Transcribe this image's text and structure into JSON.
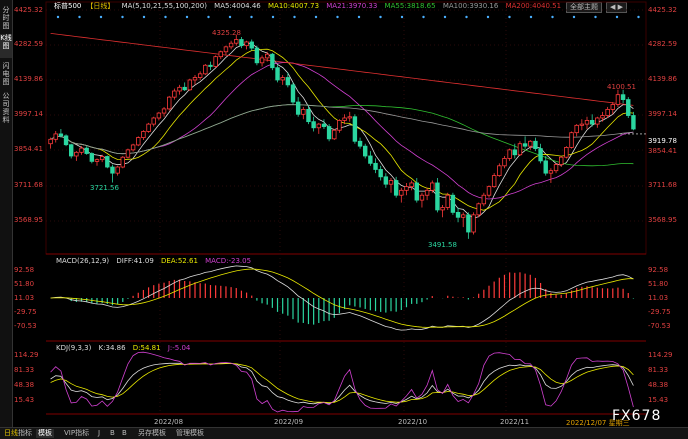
{
  "sidebar": {
    "tabs": [
      {
        "label": "分时图",
        "active": false
      },
      {
        "label": "K线图",
        "active": true
      },
      {
        "label": "闪电图",
        "active": false
      },
      {
        "label": "公司资料",
        "active": false
      }
    ]
  },
  "header": {
    "name": "标普500",
    "period": "【日线】",
    "ma": [
      {
        "label": "MA(5,10,21,55,100,200)",
        "color": "#dddddd"
      },
      {
        "label": "MA5:4004.46",
        "color": "#dddddd"
      },
      {
        "label": "MA10:4007.73",
        "color": "#e8e800"
      },
      {
        "label": "MA21:3970.33",
        "color": "#d040d0"
      },
      {
        "label": "MA55:3818.65",
        "color": "#30c030"
      },
      {
        "label": "MA100:3930.16",
        "color": "#999999"
      },
      {
        "label": "MA200:4040.51",
        "color": "#e03030"
      }
    ],
    "buttons": {
      "all": "全部主题",
      "nav": "◀ ▶"
    }
  },
  "price_axis": {
    "left": [
      "4425.32",
      "4282.59",
      "4139.86",
      "3997.14",
      "3854.41",
      "3711.68",
      "3568.95"
    ],
    "right": [
      "4425.32",
      "4282.59",
      "4139.86",
      "3997.14",
      "3854.41",
      "3711.68",
      "3568.95"
    ],
    "last": "3919.78"
  },
  "annotations": {
    "high": "4325.28",
    "low_left": "3721.56",
    "low": "3491.58",
    "recent_high": "4100.51"
  },
  "macd": {
    "title": "MACD(26,12,9)",
    "diff": "DIFF:41.09",
    "dea": "DEA:52.61",
    "macd": "MACD:-23.05",
    "axis": [
      "92.58",
      "51.80",
      "11.03",
      "-29.75",
      "-70.53"
    ]
  },
  "kdj": {
    "title": "KDJ(9,3,3)",
    "k": "K:34.86",
    "d": "D:54.81",
    "j": "J:-5.04",
    "axis": [
      "114.29",
      "81.33",
      "48.38",
      "15.43"
    ]
  },
  "x_axis": [
    "2022/08",
    "2022/09",
    "2022/10",
    "2022/11"
  ],
  "status": {
    "date": "2022/12/07 星期三"
  },
  "bottom_tabs": [
    {
      "label": "日线",
      "active": false
    },
    {
      "label": "指标",
      "active": false
    },
    {
      "label": "模板",
      "active": true
    },
    {
      "label": "VIP指标",
      "active": false
    },
    {
      "label": "J",
      "active": false
    },
    {
      "label": "B",
      "active": false
    },
    {
      "label": "B",
      "active": false
    },
    {
      "label": "另存模板",
      "active": false
    },
    {
      "label": "管理模板",
      "active": false
    }
  ],
  "brand": "FX678",
  "colors": {
    "up": "#ff3b3b",
    "down": "#2bd6a0",
    "bg": "#000000"
  },
  "chart_data": {
    "type": "candlestick",
    "candles": [
      [
        3880,
        3905,
        3860,
        3898
      ],
      [
        3898,
        3932,
        3885,
        3920
      ],
      [
        3920,
        3940,
        3905,
        3912
      ],
      [
        3912,
        3918,
        3870,
        3876
      ],
      [
        3876,
        3880,
        3820,
        3830
      ],
      [
        3830,
        3850,
        3810,
        3845
      ],
      [
        3845,
        3870,
        3835,
        3862
      ],
      [
        3862,
        3870,
        3835,
        3840
      ],
      [
        3840,
        3845,
        3800,
        3808
      ],
      [
        3808,
        3820,
        3790,
        3815
      ],
      [
        3815,
        3835,
        3805,
        3828
      ],
      [
        3828,
        3832,
        3780,
        3785
      ],
      [
        3785,
        3795,
        3722,
        3760
      ],
      [
        3760,
        3790,
        3750,
        3785
      ],
      [
        3785,
        3830,
        3780,
        3825
      ],
      [
        3825,
        3860,
        3820,
        3855
      ],
      [
        3855,
        3880,
        3848,
        3875
      ],
      [
        3875,
        3910,
        3870,
        3905
      ],
      [
        3905,
        3935,
        3895,
        3930
      ],
      [
        3930,
        3965,
        3925,
        3960
      ],
      [
        3960,
        3990,
        3950,
        3985
      ],
      [
        3985,
        4010,
        3975,
        4005
      ],
      [
        4005,
        4030,
        3990,
        4022
      ],
      [
        4022,
        4075,
        4015,
        4070
      ],
      [
        4070,
        4105,
        4060,
        4095
      ],
      [
        4095,
        4120,
        4080,
        4110
      ],
      [
        4110,
        4130,
        4095,
        4100
      ],
      [
        4100,
        4145,
        4095,
        4140
      ],
      [
        4140,
        4160,
        4120,
        4150
      ],
      [
        4150,
        4175,
        4140,
        4165
      ],
      [
        4165,
        4205,
        4160,
        4200
      ],
      [
        4200,
        4215,
        4180,
        4195
      ],
      [
        4195,
        4240,
        4190,
        4235
      ],
      [
        4235,
        4260,
        4225,
        4255
      ],
      [
        4255,
        4280,
        4240,
        4275
      ],
      [
        4275,
        4300,
        4265,
        4290
      ],
      [
        4290,
        4325,
        4280,
        4305
      ],
      [
        4305,
        4315,
        4270,
        4280
      ],
      [
        4280,
        4300,
        4265,
        4295
      ],
      [
        4295,
        4305,
        4260,
        4270
      ],
      [
        4270,
        4280,
        4200,
        4210
      ],
      [
        4210,
        4240,
        4195,
        4230
      ],
      [
        4230,
        4255,
        4215,
        4245
      ],
      [
        4245,
        4250,
        4180,
        4190
      ],
      [
        4190,
        4200,
        4130,
        4140
      ],
      [
        4140,
        4160,
        4120,
        4150
      ],
      [
        4150,
        4170,
        4110,
        4120
      ],
      [
        4120,
        4130,
        4040,
        4050
      ],
      [
        4050,
        4070,
        3990,
        4000
      ],
      [
        4000,
        4030,
        3980,
        4020
      ],
      [
        4020,
        4035,
        3960,
        3970
      ],
      [
        3970,
        3990,
        3930,
        3945
      ],
      [
        3945,
        3965,
        3920,
        3960
      ],
      [
        3960,
        3980,
        3940,
        3950
      ],
      [
        3950,
        3960,
        3890,
        3900
      ],
      [
        3900,
        3940,
        3895,
        3935
      ],
      [
        3935,
        3980,
        3925,
        3975
      ],
      [
        3975,
        4000,
        3960,
        3985
      ],
      [
        3985,
        4010,
        3970,
        3990
      ],
      [
        3990,
        4000,
        3880,
        3890
      ],
      [
        3890,
        3905,
        3860,
        3870
      ],
      [
        3870,
        3880,
        3820,
        3830
      ],
      [
        3830,
        3850,
        3790,
        3800
      ],
      [
        3800,
        3820,
        3760,
        3775
      ],
      [
        3775,
        3790,
        3730,
        3745
      ],
      [
        3745,
        3760,
        3700,
        3715
      ],
      [
        3715,
        3740,
        3680,
        3730
      ],
      [
        3730,
        3745,
        3660,
        3670
      ],
      [
        3670,
        3700,
        3640,
        3690
      ],
      [
        3690,
        3720,
        3670,
        3705
      ],
      [
        3705,
        3730,
        3690,
        3720
      ],
      [
        3720,
        3740,
        3640,
        3650
      ],
      [
        3650,
        3680,
        3620,
        3670
      ],
      [
        3670,
        3700,
        3650,
        3690
      ],
      [
        3690,
        3730,
        3680,
        3720
      ],
      [
        3720,
        3740,
        3600,
        3610
      ],
      [
        3610,
        3630,
        3580,
        3620
      ],
      [
        3620,
        3680,
        3610,
        3670
      ],
      [
        3670,
        3680,
        3590,
        3600
      ],
      [
        3600,
        3620,
        3560,
        3580
      ],
      [
        3580,
        3600,
        3540,
        3590
      ],
      [
        3590,
        3600,
        3492,
        3520
      ],
      [
        3520,
        3600,
        3510,
        3590
      ],
      [
        3590,
        3640,
        3580,
        3635
      ],
      [
        3635,
        3680,
        3625,
        3670
      ],
      [
        3670,
        3710,
        3660,
        3705
      ],
      [
        3705,
        3760,
        3700,
        3750
      ],
      [
        3750,
        3800,
        3745,
        3790
      ],
      [
        3790,
        3830,
        3780,
        3820
      ],
      [
        3820,
        3860,
        3810,
        3855
      ],
      [
        3855,
        3880,
        3820,
        3835
      ],
      [
        3835,
        3890,
        3830,
        3880
      ],
      [
        3880,
        3910,
        3860,
        3870
      ],
      [
        3870,
        3895,
        3855,
        3890
      ],
      [
        3890,
        3905,
        3850,
        3860
      ],
      [
        3860,
        3880,
        3800,
        3810
      ],
      [
        3810,
        3830,
        3750,
        3760
      ],
      [
        3760,
        3780,
        3720,
        3770
      ],
      [
        3770,
        3800,
        3760,
        3795
      ],
      [
        3795,
        3830,
        3785,
        3825
      ],
      [
        3825,
        3870,
        3820,
        3865
      ],
      [
        3865,
        3930,
        3860,
        3925
      ],
      [
        3925,
        3960,
        3910,
        3955
      ],
      [
        3955,
        3980,
        3935,
        3960
      ],
      [
        3960,
        3990,
        3940,
        3975
      ],
      [
        3975,
        4000,
        3950,
        3960
      ],
      [
        3960,
        3990,
        3945,
        3985
      ],
      [
        3985,
        4010,
        3970,
        3995
      ],
      [
        3995,
        4030,
        3985,
        4020
      ],
      [
        4020,
        4050,
        4000,
        4040
      ],
      [
        4040,
        4100,
        4030,
        4080
      ],
      [
        4080,
        4100,
        4045,
        4060
      ],
      [
        4060,
        4070,
        3985,
        3995
      ],
      [
        3995,
        4010,
        3935,
        3940
      ]
    ]
  }
}
